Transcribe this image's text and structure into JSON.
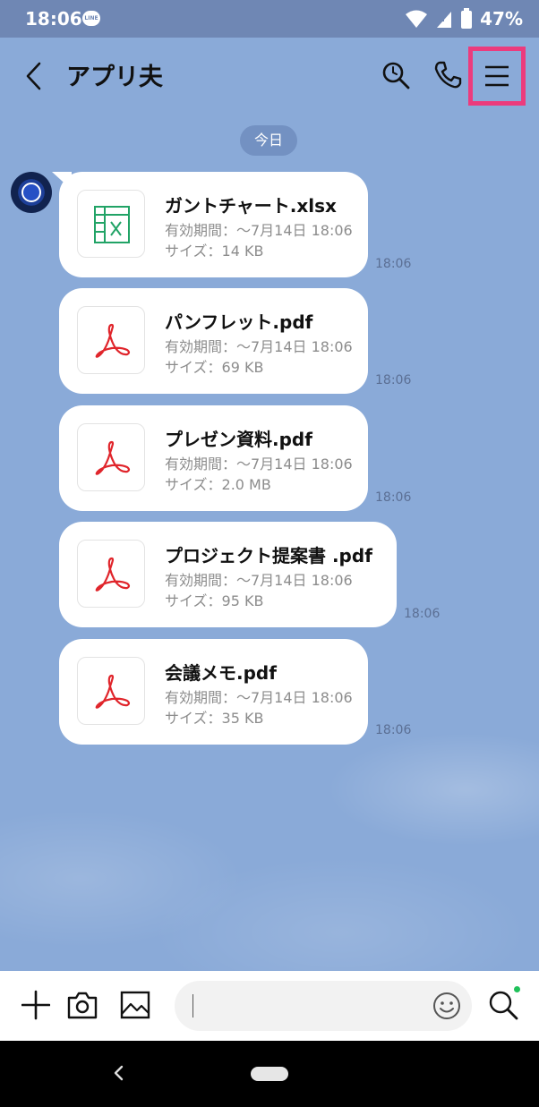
{
  "status_bar": {
    "time": "18:06",
    "battery": "47%"
  },
  "header": {
    "title": "アプリ夫"
  },
  "date_chip": "今日",
  "messages": [
    {
      "name": "ガントチャート.xlsx",
      "expiry": "有効期間：〜7月14日 18:06",
      "size": "サイズ：14 KB",
      "time": "18:06",
      "icon": "excel-file-icon"
    },
    {
      "name": "パンフレット.pdf",
      "expiry": "有効期間：〜7月14日 18:06",
      "size": "サイズ：69 KB",
      "time": "18:06",
      "icon": "pdf-file-icon"
    },
    {
      "name": "プレゼン資料.pdf",
      "expiry": "有効期間：〜7月14日 18:06",
      "size": "サイズ：2.0 MB",
      "time": "18:06",
      "icon": "pdf-file-icon"
    },
    {
      "name": "プロジェクト提案書 .pdf",
      "expiry": "有効期間：〜7月14日 18:06",
      "size": "サイズ：95 KB",
      "time": "18:06",
      "icon": "pdf-file-icon"
    },
    {
      "name": "会議メモ.pdf",
      "expiry": "有効期間：〜7月14日 18:06",
      "size": "サイズ：35 KB",
      "time": "18:06",
      "icon": "pdf-file-icon"
    }
  ],
  "colors": {
    "chat_background": "#8aaad8",
    "status_bar": "#6f87b4",
    "highlight_box": "#ec3b7d",
    "pdf_red": "#e0252b",
    "excel_green": "#21a366"
  }
}
